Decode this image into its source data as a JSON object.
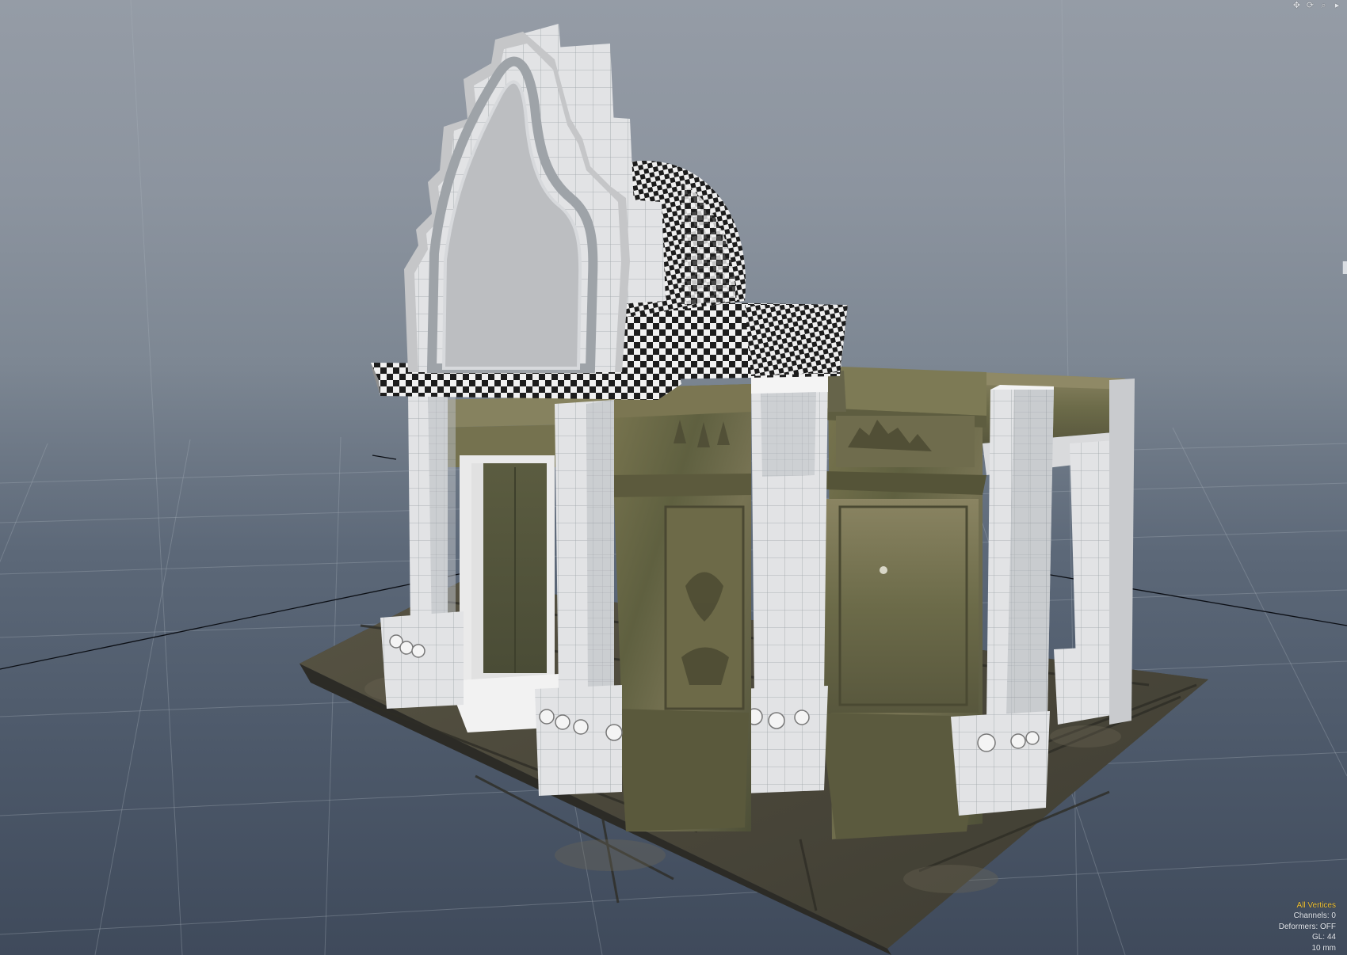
{
  "viewport": {
    "nav_icons": [
      {
        "name": "move-view-icon",
        "glyph": "✥"
      },
      {
        "name": "rotate-view-icon",
        "glyph": "⟳"
      },
      {
        "name": "zoom-view-icon",
        "glyph": "⌕"
      },
      {
        "name": "maximize-viewport-icon",
        "glyph": "▸"
      }
    ],
    "hud": {
      "selection_mode": "All Vertices",
      "channels": "Channels: 0",
      "deformers": "Deformers: OFF",
      "gl": "GL: 44",
      "scale": "10 mm"
    }
  },
  "colors": {
    "background_top": "#959ca6",
    "background_bottom": "#3f4a5b",
    "grid_line": "#a9b2bc",
    "hud_text": "#e8ebf0",
    "hud_accent": "#f1c232",
    "untextured_geometry": "#e6e6e6",
    "mossy_stone": "#6d6a44",
    "checker_dark": "#222222"
  }
}
